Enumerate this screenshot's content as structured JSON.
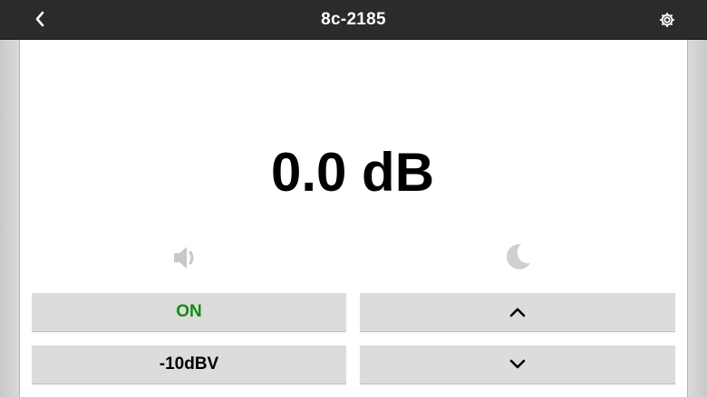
{
  "header": {
    "title": "8c-2185",
    "back_icon": "chevron-left-icon",
    "settings_icon": "gear-icon"
  },
  "volume": {
    "level_text": "0.0 dB"
  },
  "indicators": {
    "mute_icon": "speaker-icon",
    "sleep_icon": "moon-icon"
  },
  "controls": {
    "power_label": "ON",
    "power_color": "#158a15",
    "volume_up_icon": "chevron-up-icon",
    "input_sensitivity_label": "-10dBV",
    "volume_down_icon": "chevron-down-icon"
  },
  "colors": {
    "topbar": "#2b2b2b",
    "button_bg": "#dcdcdc",
    "icon_inactive": "#c8c8c8"
  }
}
